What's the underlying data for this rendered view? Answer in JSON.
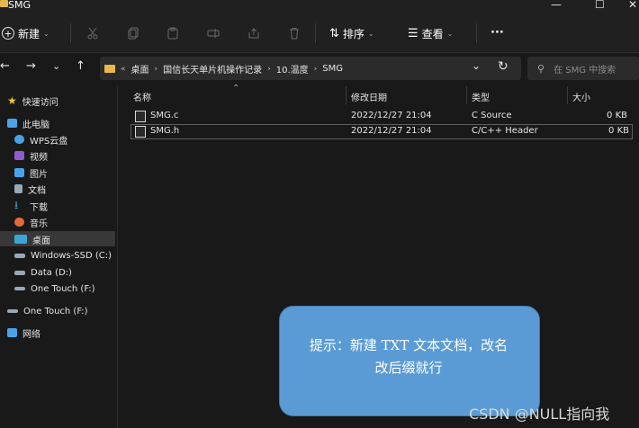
{
  "window": {
    "title": "SMG",
    "min": "—",
    "max": "☐",
    "close": "✕"
  },
  "toolbar": {
    "new_label": "新建",
    "sort_label": "排序",
    "view_label": "查看",
    "more_label": "···"
  },
  "address": {
    "crumbs": [
      "«",
      "桌面",
      "国信长天单片机操作记录",
      "10.温度",
      "SMG"
    ],
    "dropdown_icon": "⌄",
    "refresh_icon": "↻"
  },
  "search": {
    "placeholder": "在 SMG 中搜索"
  },
  "sidebar": {
    "items": [
      {
        "label": "快速访问",
        "icon": "star-icon",
        "color": "#f2c037"
      },
      {
        "label": "此电脑",
        "icon": "pc-icon",
        "color": "#4aa3e8"
      },
      {
        "label": "WPS云盘",
        "icon": "cloud-icon",
        "color": "#4aa3e8"
      },
      {
        "label": "视频",
        "icon": "video-icon",
        "color": "#8e5ccc"
      },
      {
        "label": "图片",
        "icon": "picture-icon",
        "color": "#4aa3e8"
      },
      {
        "label": "文档",
        "icon": "document-icon",
        "color": "#9aa7b8"
      },
      {
        "label": "下载",
        "icon": "download-icon",
        "color": "#3aa6d8"
      },
      {
        "label": "音乐",
        "icon": "music-icon",
        "color": "#e06a3b"
      },
      {
        "label": "桌面",
        "icon": "desktop-icon",
        "color": "#3aa6d8"
      },
      {
        "label": "Windows-SSD (C:)",
        "icon": "drive-icon",
        "color": "#9aa7b8"
      },
      {
        "label": "Data (D:)",
        "icon": "drive-icon",
        "color": "#9aa7b8"
      },
      {
        "label": "One Touch (F:)",
        "icon": "drive-icon",
        "color": "#9aa7b8"
      },
      {
        "label": "One Touch (F:)",
        "icon": "drive-icon",
        "color": "#9aa7b8"
      },
      {
        "label": "网络",
        "icon": "network-icon",
        "color": "#4aa3e8"
      }
    ]
  },
  "columns": {
    "name": "名称",
    "modified": "修改日期",
    "type": "类型",
    "size": "大小"
  },
  "files": [
    {
      "name": "SMG.c",
      "modified": "2022/12/27 21:04",
      "type": "C Source",
      "size": "0 KB"
    },
    {
      "name": "SMG.h",
      "modified": "2022/12/27 21:04",
      "type": "C/C++ Header",
      "size": "0 KB"
    }
  ],
  "callout": {
    "line1": "提示：新建 TXT 文本文档，改名",
    "line2": "改后缀就行"
  },
  "watermark": "CSDN @NULL指向我"
}
